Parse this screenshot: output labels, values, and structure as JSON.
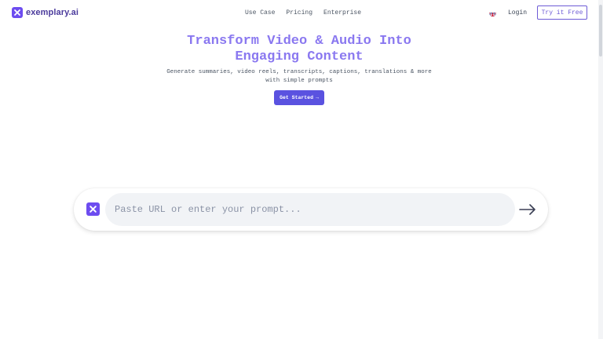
{
  "nav": {
    "brand": "exemplary.ai",
    "links": [
      "Use Case",
      "Pricing",
      "Enterprise"
    ],
    "login_label": "Login",
    "cta_label": "Try it Free",
    "language_icon": "uk-flag-icon"
  },
  "hero": {
    "title_line1": "Transform Video & Audio Into",
    "title_line2": "Engaging Content",
    "subtitle_line1": "Generate summaries, video reels, transcripts, captions, translations & more",
    "subtitle_line2": "with simple prompts",
    "cta_label": "Get Started",
    "cta_arrow": "→"
  },
  "prompt": {
    "placeholder": "Paste URL or enter your prompt...",
    "value": "",
    "send_icon": "arrow-right-icon"
  },
  "colors": {
    "brand": "#6d4cf0",
    "title": "#8a78f0",
    "cta_bg": "#5a52e0",
    "outline_button": "#6d5bd6"
  }
}
